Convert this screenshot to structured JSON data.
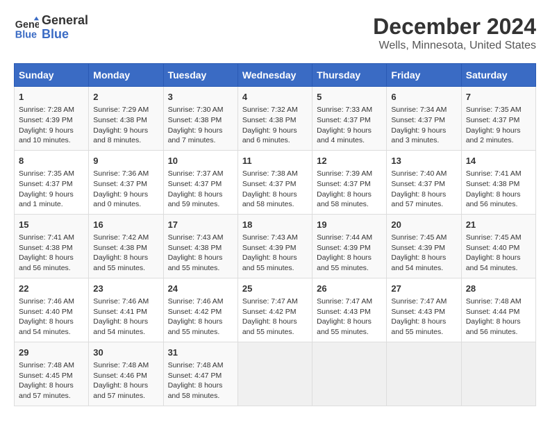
{
  "logo": {
    "line1": "General",
    "line2": "Blue"
  },
  "title": "December 2024",
  "subtitle": "Wells, Minnesota, United States",
  "days_of_week": [
    "Sunday",
    "Monday",
    "Tuesday",
    "Wednesday",
    "Thursday",
    "Friday",
    "Saturday"
  ],
  "weeks": [
    [
      {
        "day": "1",
        "sunrise": "Sunrise: 7:28 AM",
        "sunset": "Sunset: 4:39 PM",
        "daylight": "Daylight: 9 hours and 10 minutes."
      },
      {
        "day": "2",
        "sunrise": "Sunrise: 7:29 AM",
        "sunset": "Sunset: 4:38 PM",
        "daylight": "Daylight: 9 hours and 8 minutes."
      },
      {
        "day": "3",
        "sunrise": "Sunrise: 7:30 AM",
        "sunset": "Sunset: 4:38 PM",
        "daylight": "Daylight: 9 hours and 7 minutes."
      },
      {
        "day": "4",
        "sunrise": "Sunrise: 7:32 AM",
        "sunset": "Sunset: 4:38 PM",
        "daylight": "Daylight: 9 hours and 6 minutes."
      },
      {
        "day": "5",
        "sunrise": "Sunrise: 7:33 AM",
        "sunset": "Sunset: 4:37 PM",
        "daylight": "Daylight: 9 hours and 4 minutes."
      },
      {
        "day": "6",
        "sunrise": "Sunrise: 7:34 AM",
        "sunset": "Sunset: 4:37 PM",
        "daylight": "Daylight: 9 hours and 3 minutes."
      },
      {
        "day": "7",
        "sunrise": "Sunrise: 7:35 AM",
        "sunset": "Sunset: 4:37 PM",
        "daylight": "Daylight: 9 hours and 2 minutes."
      }
    ],
    [
      {
        "day": "8",
        "sunrise": "Sunrise: 7:35 AM",
        "sunset": "Sunset: 4:37 PM",
        "daylight": "Daylight: 9 hours and 1 minute."
      },
      {
        "day": "9",
        "sunrise": "Sunrise: 7:36 AM",
        "sunset": "Sunset: 4:37 PM",
        "daylight": "Daylight: 9 hours and 0 minutes."
      },
      {
        "day": "10",
        "sunrise": "Sunrise: 7:37 AM",
        "sunset": "Sunset: 4:37 PM",
        "daylight": "Daylight: 8 hours and 59 minutes."
      },
      {
        "day": "11",
        "sunrise": "Sunrise: 7:38 AM",
        "sunset": "Sunset: 4:37 PM",
        "daylight": "Daylight: 8 hours and 58 minutes."
      },
      {
        "day": "12",
        "sunrise": "Sunrise: 7:39 AM",
        "sunset": "Sunset: 4:37 PM",
        "daylight": "Daylight: 8 hours and 58 minutes."
      },
      {
        "day": "13",
        "sunrise": "Sunrise: 7:40 AM",
        "sunset": "Sunset: 4:37 PM",
        "daylight": "Daylight: 8 hours and 57 minutes."
      },
      {
        "day": "14",
        "sunrise": "Sunrise: 7:41 AM",
        "sunset": "Sunset: 4:38 PM",
        "daylight": "Daylight: 8 hours and 56 minutes."
      }
    ],
    [
      {
        "day": "15",
        "sunrise": "Sunrise: 7:41 AM",
        "sunset": "Sunset: 4:38 PM",
        "daylight": "Daylight: 8 hours and 56 minutes."
      },
      {
        "day": "16",
        "sunrise": "Sunrise: 7:42 AM",
        "sunset": "Sunset: 4:38 PM",
        "daylight": "Daylight: 8 hours and 55 minutes."
      },
      {
        "day": "17",
        "sunrise": "Sunrise: 7:43 AM",
        "sunset": "Sunset: 4:38 PM",
        "daylight": "Daylight: 8 hours and 55 minutes."
      },
      {
        "day": "18",
        "sunrise": "Sunrise: 7:43 AM",
        "sunset": "Sunset: 4:39 PM",
        "daylight": "Daylight: 8 hours and 55 minutes."
      },
      {
        "day": "19",
        "sunrise": "Sunrise: 7:44 AM",
        "sunset": "Sunset: 4:39 PM",
        "daylight": "Daylight: 8 hours and 55 minutes."
      },
      {
        "day": "20",
        "sunrise": "Sunrise: 7:45 AM",
        "sunset": "Sunset: 4:39 PM",
        "daylight": "Daylight: 8 hours and 54 minutes."
      },
      {
        "day": "21",
        "sunrise": "Sunrise: 7:45 AM",
        "sunset": "Sunset: 4:40 PM",
        "daylight": "Daylight: 8 hours and 54 minutes."
      }
    ],
    [
      {
        "day": "22",
        "sunrise": "Sunrise: 7:46 AM",
        "sunset": "Sunset: 4:40 PM",
        "daylight": "Daylight: 8 hours and 54 minutes."
      },
      {
        "day": "23",
        "sunrise": "Sunrise: 7:46 AM",
        "sunset": "Sunset: 4:41 PM",
        "daylight": "Daylight: 8 hours and 54 minutes."
      },
      {
        "day": "24",
        "sunrise": "Sunrise: 7:46 AM",
        "sunset": "Sunset: 4:42 PM",
        "daylight": "Daylight: 8 hours and 55 minutes."
      },
      {
        "day": "25",
        "sunrise": "Sunrise: 7:47 AM",
        "sunset": "Sunset: 4:42 PM",
        "daylight": "Daylight: 8 hours and 55 minutes."
      },
      {
        "day": "26",
        "sunrise": "Sunrise: 7:47 AM",
        "sunset": "Sunset: 4:43 PM",
        "daylight": "Daylight: 8 hours and 55 minutes."
      },
      {
        "day": "27",
        "sunrise": "Sunrise: 7:47 AM",
        "sunset": "Sunset: 4:43 PM",
        "daylight": "Daylight: 8 hours and 55 minutes."
      },
      {
        "day": "28",
        "sunrise": "Sunrise: 7:48 AM",
        "sunset": "Sunset: 4:44 PM",
        "daylight": "Daylight: 8 hours and 56 minutes."
      }
    ],
    [
      {
        "day": "29",
        "sunrise": "Sunrise: 7:48 AM",
        "sunset": "Sunset: 4:45 PM",
        "daylight": "Daylight: 8 hours and 57 minutes."
      },
      {
        "day": "30",
        "sunrise": "Sunrise: 7:48 AM",
        "sunset": "Sunset: 4:46 PM",
        "daylight": "Daylight: 8 hours and 57 minutes."
      },
      {
        "day": "31",
        "sunrise": "Sunrise: 7:48 AM",
        "sunset": "Sunset: 4:47 PM",
        "daylight": "Daylight: 8 hours and 58 minutes."
      },
      null,
      null,
      null,
      null
    ]
  ]
}
